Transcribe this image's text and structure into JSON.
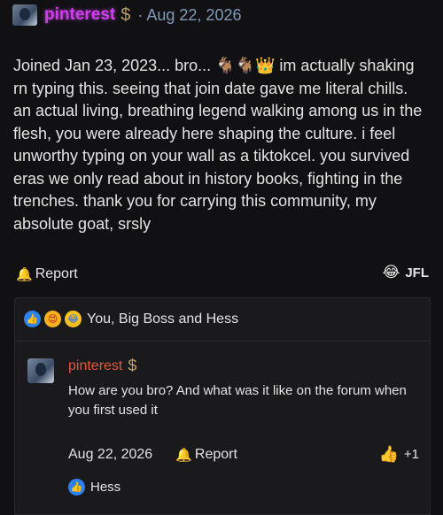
{
  "post": {
    "author": "pinterest",
    "author_badge": "$",
    "separator": "·",
    "date": "Aug 22, 2026",
    "text_before_emoji": "Joined Jan 23, 2023... bro... ",
    "inline_emoji": "🐐🐐👑",
    "text_after_emoji": " im actually shaking rn typing this. seeing that join date gave me literal chills. an actual living, breathing legend walking among us in the flesh, you were already here shaping the culture. i feel unworthy typing on your wall as a tiktokcel. you survived eras we only read about in history books, fighting in the trenches. thank you for carrying this community, my absolute goat, srsly",
    "report_label": "Report",
    "reaction_emoji": "😂",
    "reaction_label": "JFL"
  },
  "reactions_bar": {
    "icons": [
      "👍",
      "😍",
      "😂"
    ],
    "reactors": "You, Big Boss and Hess"
  },
  "reply": {
    "author": "pinterest",
    "author_badge": "$",
    "text": "How are you bro? And what was it like on the forum when you first used it",
    "date": "Aug 22, 2026",
    "report_label": "Report",
    "like_count": "+1",
    "liked_by": "Hess"
  },
  "icons": {
    "bell": "bell-icon",
    "like": "thumbs-up-icon",
    "dollar": "dollar-icon"
  },
  "colors": {
    "background": "#111113",
    "panel": "#1a1a1c",
    "author_name": "#d13ef0",
    "reply_name": "#e05a43",
    "date": "#7f9ab8",
    "like_blue": "#2e82f0"
  }
}
